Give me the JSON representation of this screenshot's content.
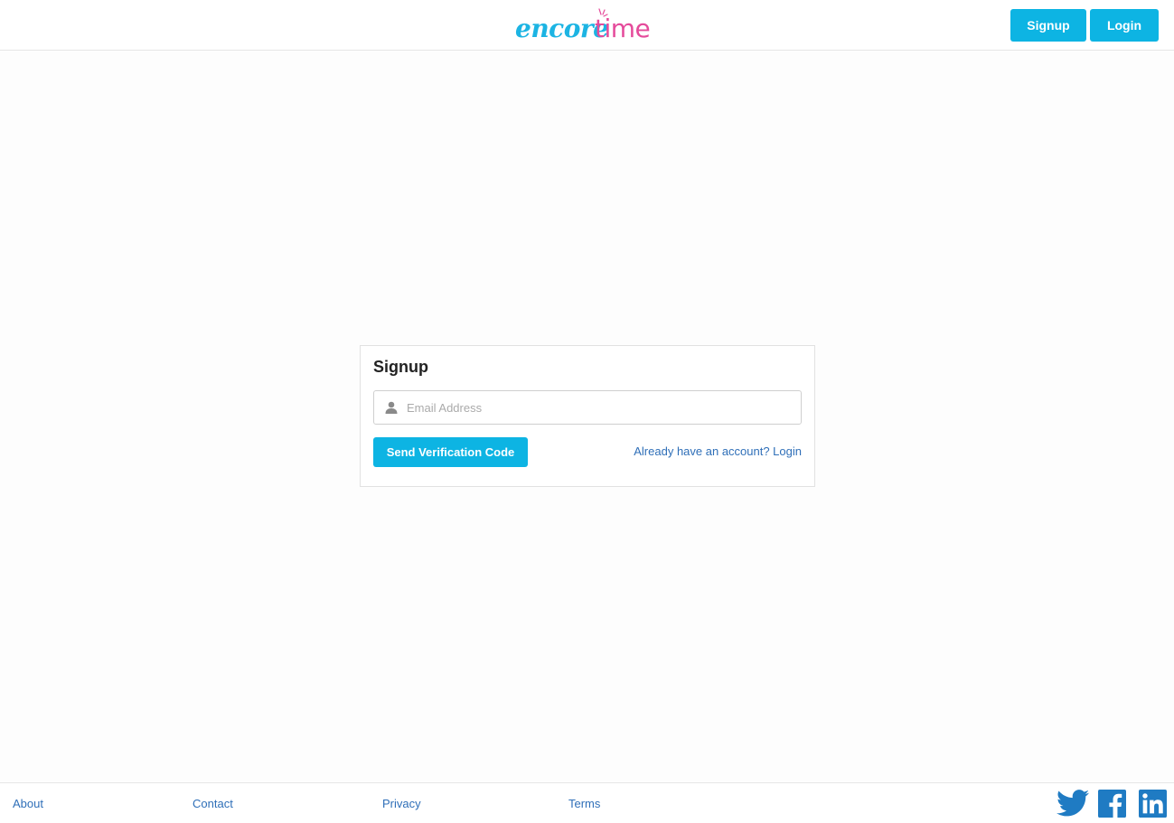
{
  "header": {
    "logo": {
      "part1": "encore",
      "part2": "time"
    },
    "signup_label": "Signup",
    "login_label": "Login"
  },
  "signup_card": {
    "title": "Signup",
    "email_placeholder": "Email Address",
    "email_value": "",
    "send_button_label": "Send Verification Code",
    "login_link_text": "Already have an account? Login"
  },
  "footer": {
    "links": [
      "About",
      "Contact",
      "Privacy",
      "Terms"
    ],
    "social": [
      "twitter-icon",
      "facebook-icon",
      "linkedin-icon"
    ]
  },
  "colors": {
    "accent": "#0db4e3",
    "brand_blue": "#1cb4e3",
    "brand_pink": "#e54b9b",
    "link": "#2f6fb8",
    "social_icon": "#1f7bc3"
  }
}
